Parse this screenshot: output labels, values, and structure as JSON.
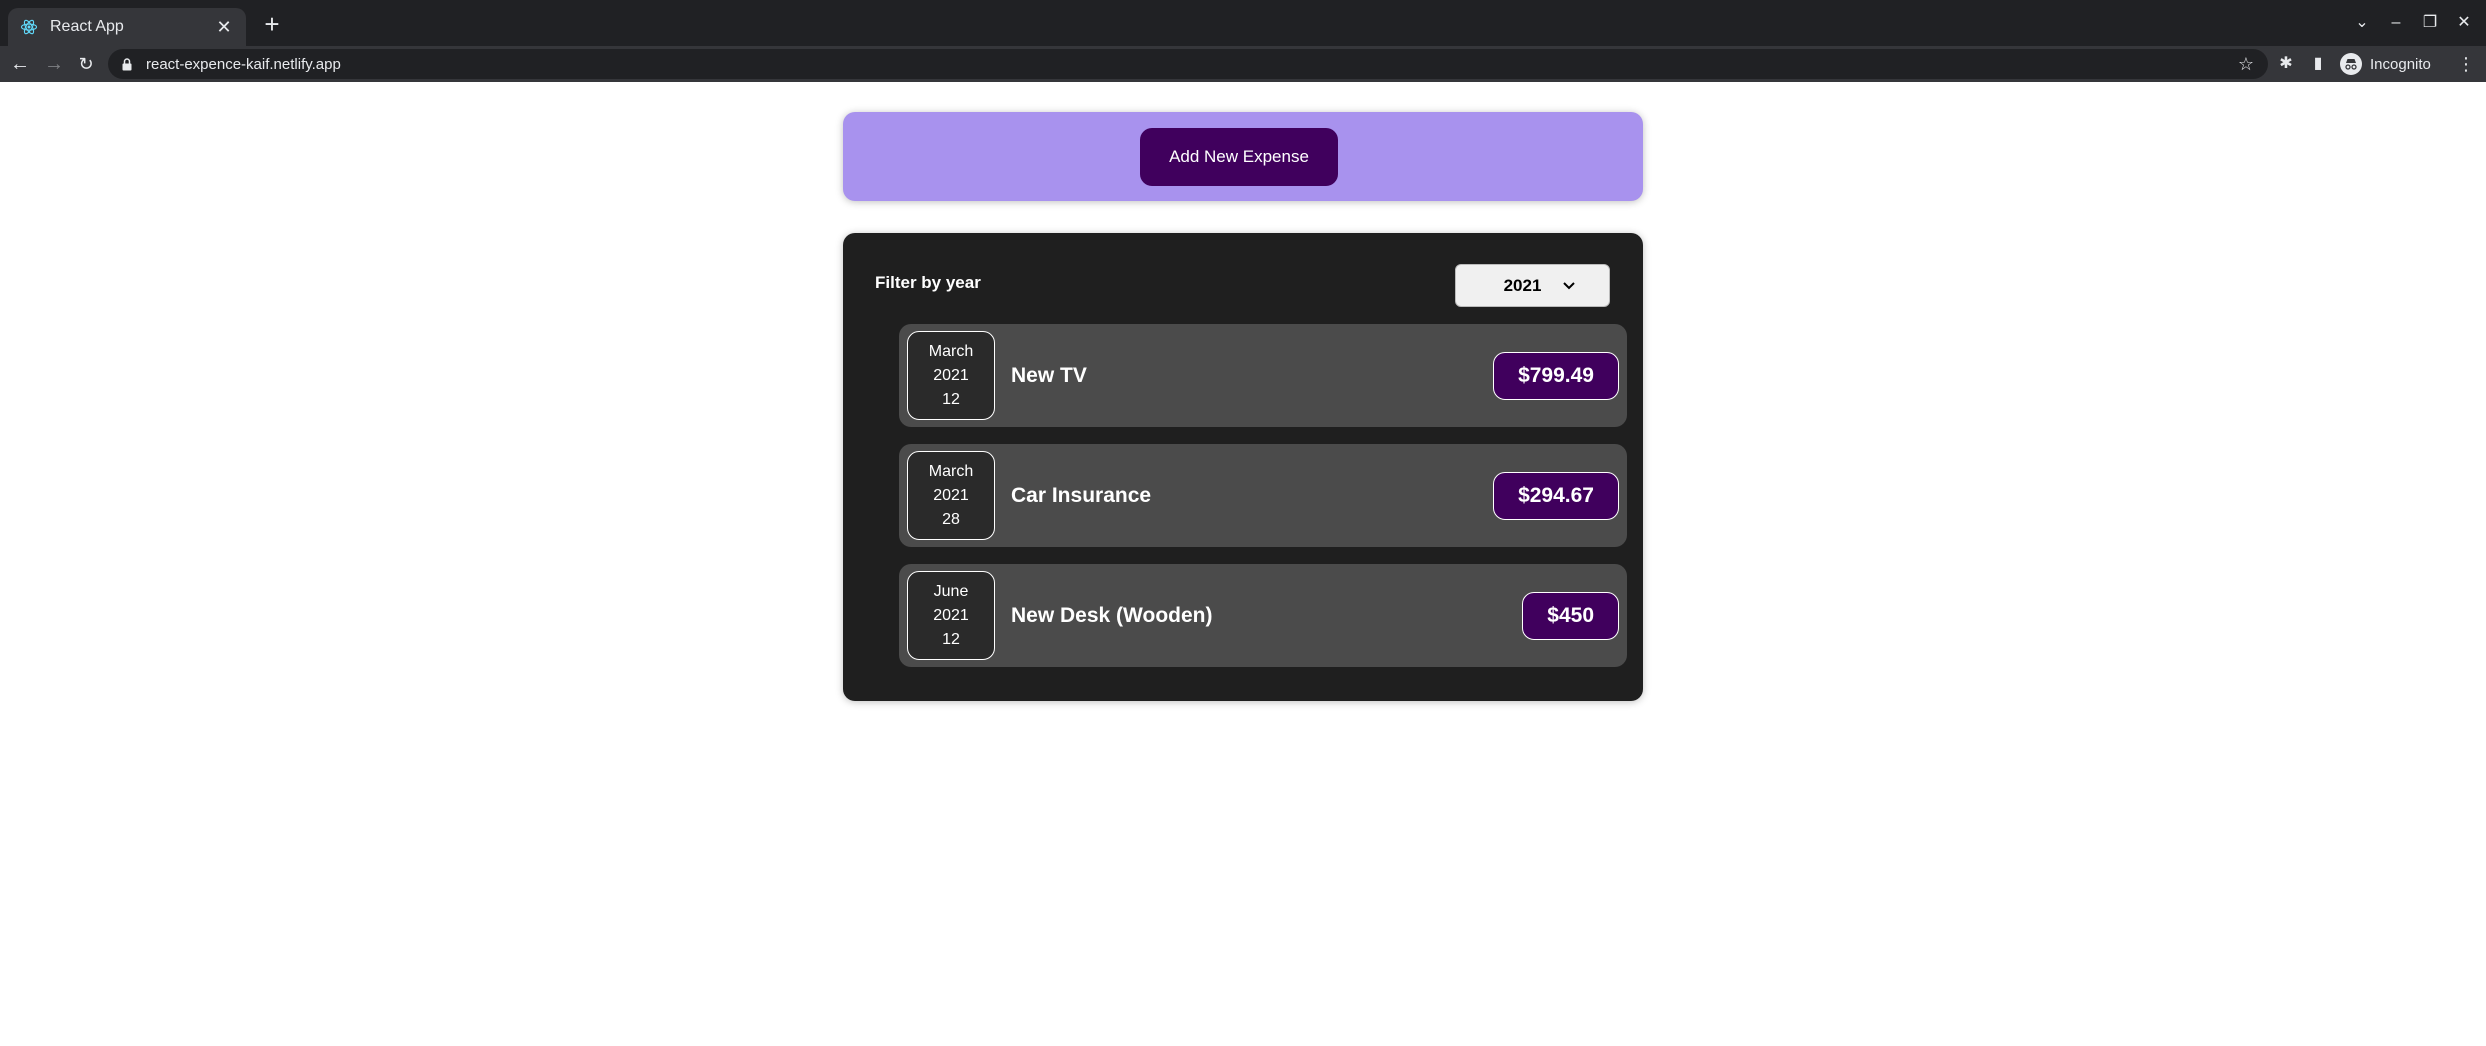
{
  "browser": {
    "tab_title": "React App",
    "url": "react-expence-kaif.netlify.app",
    "profile_label": "Incognito"
  },
  "new_expense": {
    "button_label": "Add New Expense"
  },
  "filter": {
    "label": "Filter by year",
    "selected_year": "2021"
  },
  "expenses": [
    {
      "month": "March",
      "year": "2021",
      "day": "12",
      "title": "New TV",
      "amount": "$799.49"
    },
    {
      "month": "March",
      "year": "2021",
      "day": "28",
      "title": "Car Insurance",
      "amount": "$294.67"
    },
    {
      "month": "June",
      "year": "2021",
      "day": "12",
      "title": "New Desk (Wooden)",
      "amount": "$450"
    }
  ],
  "colors": {
    "accent_purple": "#40005d",
    "panel_lavender": "#a892ee",
    "panel_dark": "#1f1f1f",
    "item_gray": "#4b4b4b"
  }
}
